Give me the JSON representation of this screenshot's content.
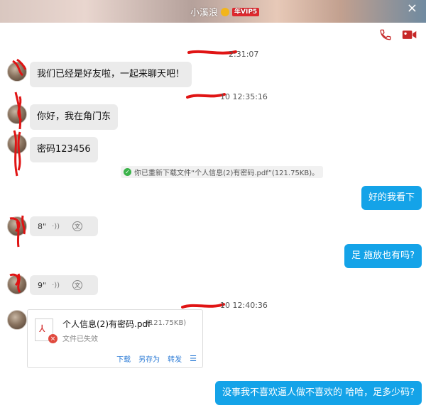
{
  "header": {
    "name": "小溪浪",
    "vip_label": "年VIP5",
    "close_glyph": "×"
  },
  "toolbar": {
    "voice_call_icon": "phone-icon",
    "video_call_icon": "video-camera-icon",
    "accent": "#c62828"
  },
  "messages": {
    "ts1": "2:31:07",
    "m1": "我们已经是好友啦，一起来聊天吧！",
    "ts2": "10 12:35:16",
    "m2": "你好，我在角门东",
    "m3": "密码123456",
    "system_notice": "你已重新下载文件“个人信息(2)有密码.pdf”(121.75KB)。",
    "m4": "好的我看下",
    "voice1": "8\"",
    "m5": "足    施放也有吗?",
    "voice2": "9\"",
    "ts3": "10 12:40:36",
    "file": {
      "name": "个人信息(2)有密码.pdf",
      "size": "(121.75KB)",
      "status": "文件已失效",
      "actions": [
        "下载",
        "另存为",
        "转发"
      ]
    },
    "m6": "没事我不喜欢逼人做不喜欢的  哈哈，足多少码?"
  },
  "colors": {
    "outgoing_bubble": "#14a3e8",
    "incoming_bubble": "#ebebeb",
    "redaction": "#e01414"
  }
}
